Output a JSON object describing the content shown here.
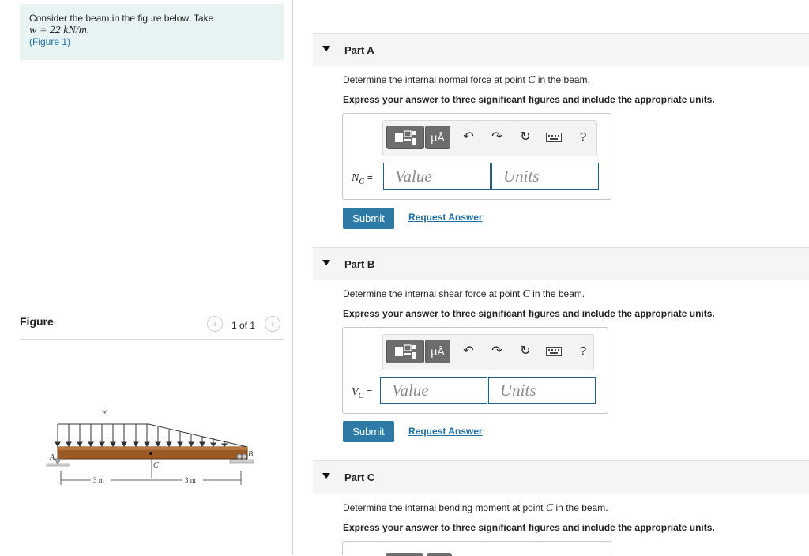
{
  "problem": {
    "intro": "Consider the beam in the figure below. Take",
    "given": "w = 22 kN/m.",
    "figure_link": "(Figure 1)"
  },
  "figure": {
    "title": "Figure",
    "page_indicator": "1 of 1",
    "prev_icon": "chevron-left-icon",
    "next_icon": "chevron-right-icon",
    "labels": {
      "load": "w",
      "point_a": "A",
      "point_b": "B",
      "point_c": "C",
      "dim_1": "3 m",
      "dim_2": "3 m"
    }
  },
  "toolbar": {
    "templates_icon": "templates-icon",
    "units_label": "μÅ",
    "undo_icon": "undo-icon",
    "redo_icon": "redo-icon",
    "reset_icon": "reset-icon",
    "keyboard_icon": "keyboard-icon",
    "help_label": "?"
  },
  "parts": [
    {
      "title": "Part A",
      "question_pre": "Determine the internal normal force at point",
      "question_sym": "C",
      "question_post": "in the beam.",
      "instruction": "Express your answer to three significant figures and include the appropriate units.",
      "var_letter": "N",
      "var_sub": "C",
      "value_placeholder": "Value",
      "units_placeholder": "Units",
      "submit_label": "Submit",
      "request_label": "Request Answer"
    },
    {
      "title": "Part B",
      "question_pre": "Determine the internal shear force at point",
      "question_sym": "C",
      "question_post": "in the beam.",
      "instruction": "Express your answer to three significant figures and include the appropriate units.",
      "var_letter": "V",
      "var_sub": "C",
      "value_placeholder": "Value",
      "units_placeholder": "Units",
      "submit_label": "Submit",
      "request_label": "Request Answer"
    },
    {
      "title": "Part C",
      "question_pre": "Determine the internal bending moment at point",
      "question_sym": "C",
      "question_post": "in the beam.",
      "instruction": "Express your answer to three significant figures and include the appropriate units."
    }
  ]
}
